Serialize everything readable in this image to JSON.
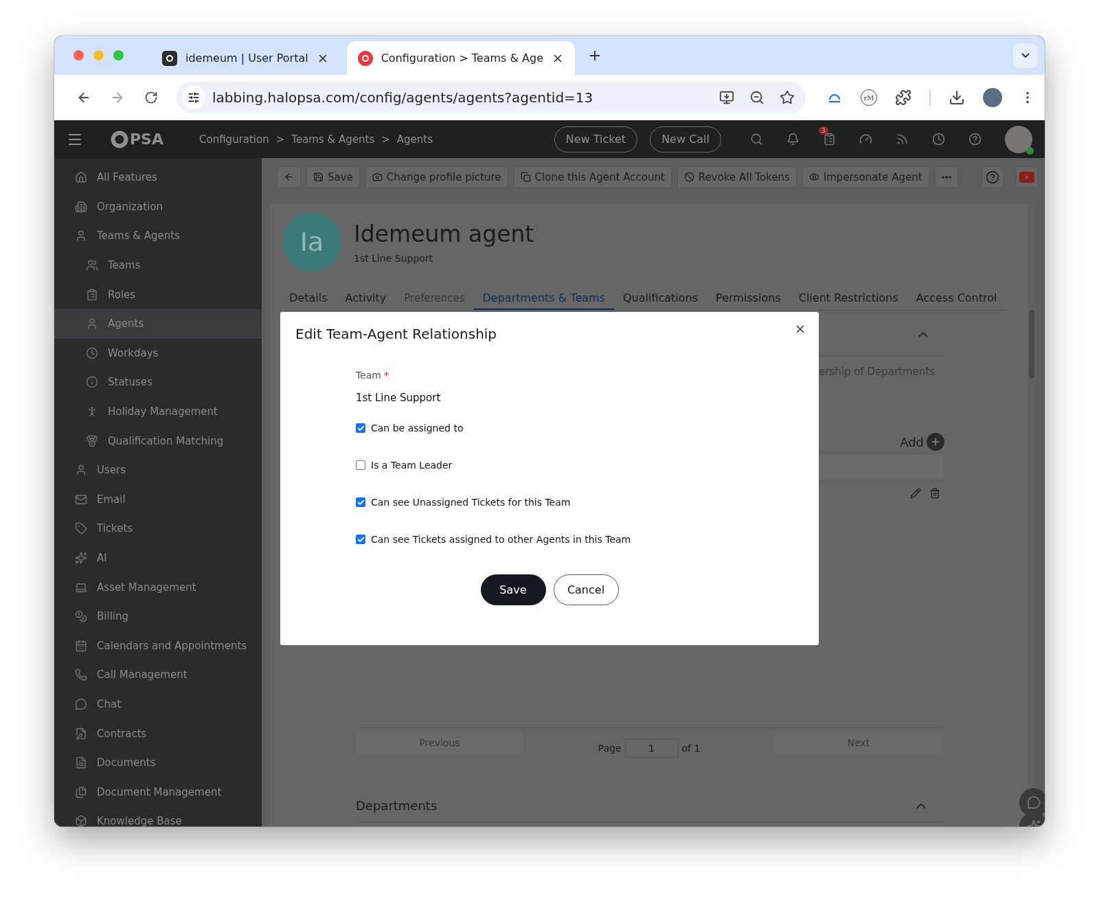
{
  "browser": {
    "tabs": [
      {
        "title": "idemeum | User Portal",
        "selected": false
      },
      {
        "title": "Configuration > Teams & Age",
        "selected": true
      }
    ],
    "url": "labbing.halopsa.com/config/agents/agents?agentid=13",
    "extension_badge": "rM"
  },
  "nav": {
    "logo_text": "PSA",
    "breadcrumbs": [
      "Configuration",
      "Teams & Agents",
      "Agents"
    ],
    "separator": ">",
    "buttons": [
      "New Ticket",
      "New Call"
    ],
    "notification_badge": "3"
  },
  "sidebar": {
    "items": [
      {
        "label": "All Features",
        "selected": false
      },
      {
        "label": "Organization",
        "selected": false
      },
      {
        "label": "Teams & Agents",
        "selected": false,
        "children": [
          {
            "label": "Teams",
            "selected": false
          },
          {
            "label": "Roles",
            "selected": false
          },
          {
            "label": "Agents",
            "selected": true
          },
          {
            "label": "Workdays",
            "selected": false
          },
          {
            "label": "Statuses",
            "selected": false
          },
          {
            "label": "Holiday Management",
            "selected": false
          },
          {
            "label": "Qualification Matching",
            "selected": false
          }
        ]
      },
      {
        "label": "Users",
        "selected": false
      },
      {
        "label": "Email",
        "selected": false
      },
      {
        "label": "Tickets",
        "selected": false
      },
      {
        "label": "AI",
        "selected": false
      },
      {
        "label": "Asset Management",
        "selected": false
      },
      {
        "label": "Billing",
        "selected": false
      },
      {
        "label": "Calendars and Appointments",
        "selected": false
      },
      {
        "label": "Call Management",
        "selected": false
      },
      {
        "label": "Chat",
        "selected": false
      },
      {
        "label": "Contracts",
        "selected": false
      },
      {
        "label": "Documents",
        "selected": false
      },
      {
        "label": "Document Management",
        "selected": false
      },
      {
        "label": "Knowledge Base",
        "selected": false
      }
    ]
  },
  "toolbar": {
    "buttons": [
      "Save",
      "Change profile picture",
      "Clone this Agent Account",
      "Revoke All Tokens",
      "Impersonate Agent"
    ]
  },
  "profile": {
    "initials": "Ia",
    "name": "Idemeum agent",
    "subtitle": "1st Line Support"
  },
  "tabs": [
    {
      "label": "Details",
      "selected": false,
      "disabled": false
    },
    {
      "label": "Activity",
      "selected": false,
      "disabled": false
    },
    {
      "label": "Preferences",
      "selected": false,
      "disabled": true
    },
    {
      "label": "Departments & Teams",
      "selected": true,
      "disabled": false
    },
    {
      "label": "Qualifications",
      "selected": false,
      "disabled": false
    },
    {
      "label": "Permissions",
      "selected": false,
      "disabled": false
    },
    {
      "label": "Client Restrictions",
      "selected": false,
      "disabled": false
    },
    {
      "label": "Access Control",
      "selected": false,
      "disabled": false
    }
  ],
  "background": {
    "section_text": "ership of Departments",
    "add_label": "Add",
    "pagination": {
      "previous": "Previous",
      "page_label": "Page",
      "page_value": "1",
      "of_label": "of 1",
      "next": "Next"
    },
    "departments_title": "Departments"
  },
  "dialog": {
    "title": "Edit Team-Agent Relationship",
    "team_label": "Team",
    "required_mark": "*",
    "team_value": "1st Line Support",
    "options": [
      {
        "label": "Can be assigned to",
        "checked": true
      },
      {
        "label": "Is a Team Leader",
        "checked": false
      },
      {
        "label": "Can see Unassigned Tickets for this Team",
        "checked": true
      },
      {
        "label": "Can see Tickets assigned to other Agents in this Team",
        "checked": true
      }
    ],
    "buttons": [
      {
        "label": "Save",
        "kind": "primary"
      },
      {
        "label": "Cancel",
        "kind": "secondary"
      }
    ]
  }
}
